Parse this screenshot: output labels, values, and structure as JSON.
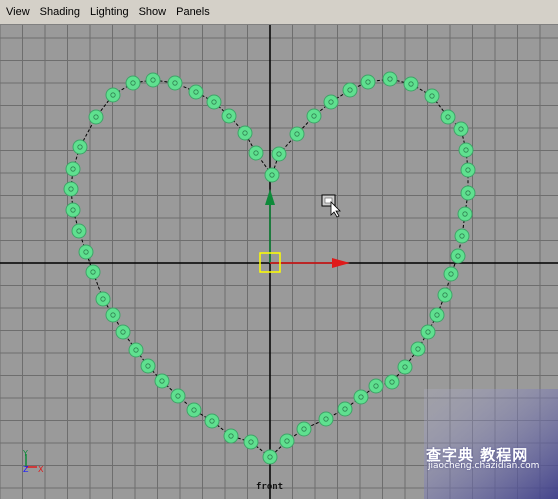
{
  "menu": {
    "items": [
      "View",
      "Shading",
      "Lighting",
      "Show",
      "Panels"
    ]
  },
  "viewport": {
    "camera": "front",
    "background_color": "#9a9a9a",
    "grid_color": "#6e6e6e",
    "axis_color": "#000000",
    "curve_color": "#000000",
    "cv_color": "#5fe08f",
    "cv_outline_color": "#3fa368",
    "manipulator": {
      "x_arrow_color": "#e01a1a",
      "y_arrow_color": "#0e8a3a",
      "center_color": "#ffff00"
    },
    "axis_indicator": {
      "y_label": "Y",
      "z_label": "Z",
      "x_label": "X",
      "y_color": "#0e8a3a",
      "z_color": "#1a1aff",
      "x_color": "#e01a1a"
    }
  },
  "watermark": {
    "text": "查字典 教程网",
    "url": "jiaocheng.chazidian.com"
  }
}
